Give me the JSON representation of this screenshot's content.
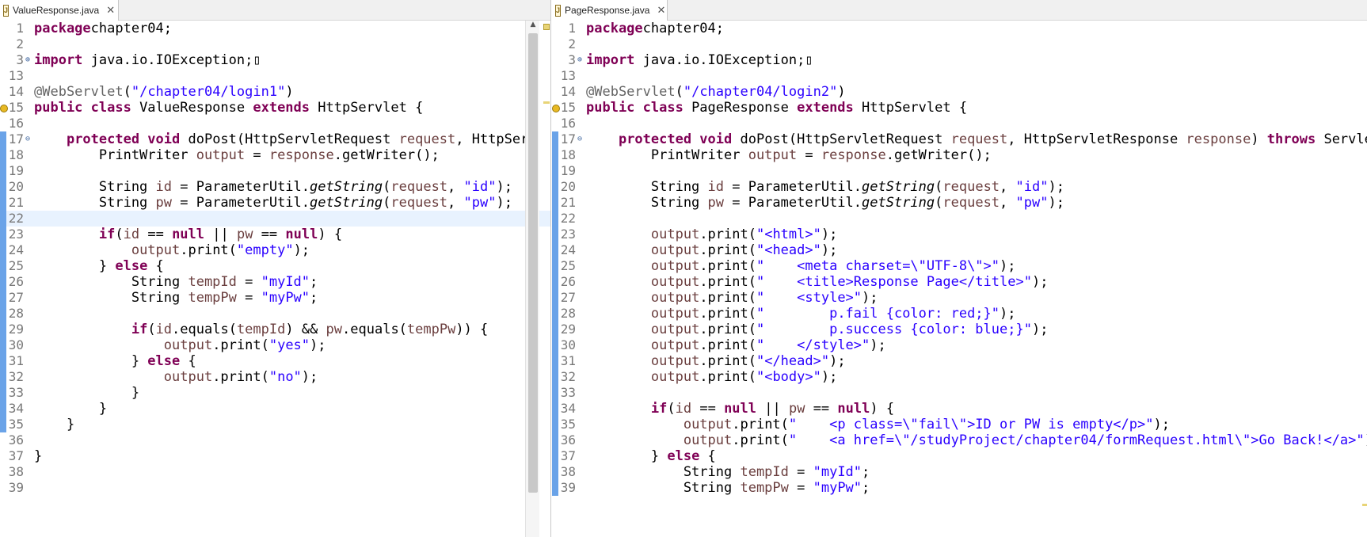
{
  "left_tab": {
    "label": "ValueResponse.java",
    "icon": "java-file-icon",
    "close": "✕"
  },
  "right_tab": {
    "label": "PageResponse.java",
    "icon": "java-file-icon",
    "close": "✕"
  },
  "left_lines": [
    {
      "n": "1",
      "marker": "",
      "warn": false,
      "hl": false,
      "t": [
        [
          "k",
          "package"
        ],
        [
          "",
          "chapter04;"
        ]
      ]
    },
    {
      "n": "2",
      "marker": "",
      "warn": false,
      "hl": false,
      "t": []
    },
    {
      "n": "3",
      "marker": "⊕",
      "warn": false,
      "hl": false,
      "t": [
        [
          "k",
          "import"
        ],
        [
          "",
          " java.io.IOException;▯"
        ]
      ]
    },
    {
      "n": "13",
      "marker": "",
      "warn": false,
      "hl": false,
      "t": []
    },
    {
      "n": "14",
      "marker": "",
      "warn": false,
      "hl": false,
      "t": [
        [
          "a",
          "@WebServlet"
        ],
        [
          "",
          "("
        ],
        [
          "s",
          "\"/chapter04/login1\""
        ],
        [
          "",
          ")"
        ]
      ]
    },
    {
      "n": "15",
      "marker": "",
      "warn": true,
      "hl": false,
      "t": [
        [
          "k",
          "public class"
        ],
        [
          "",
          " ValueResponse "
        ],
        [
          "k",
          "extends"
        ],
        [
          "",
          " HttpServlet {"
        ]
      ]
    },
    {
      "n": "16",
      "marker": "",
      "warn": false,
      "hl": false,
      "t": []
    },
    {
      "n": "17",
      "marker": "⊖",
      "warn": false,
      "hl": false,
      "t": [
        [
          "",
          "    "
        ],
        [
          "k",
          "protected void"
        ],
        [
          "",
          " doPost(HttpServletRequest "
        ],
        [
          "v",
          "request"
        ],
        [
          "",
          ", HttpServ"
        ]
      ]
    },
    {
      "n": "18",
      "marker": "",
      "warn": false,
      "hl": false,
      "t": [
        [
          "",
          "        PrintWriter "
        ],
        [
          "v",
          "output"
        ],
        [
          "",
          " = "
        ],
        [
          "v",
          "response"
        ],
        [
          "",
          ".getWriter();"
        ]
      ]
    },
    {
      "n": "19",
      "marker": "",
      "warn": false,
      "hl": false,
      "t": []
    },
    {
      "n": "20",
      "marker": "",
      "warn": false,
      "hl": false,
      "t": [
        [
          "",
          "        String "
        ],
        [
          "v",
          "id"
        ],
        [
          "",
          " = ParameterUtil."
        ],
        [
          "i",
          "getString"
        ],
        [
          "",
          "("
        ],
        [
          "v",
          "request"
        ],
        [
          "",
          ", "
        ],
        [
          "s",
          "\"id\""
        ],
        [
          "",
          ");"
        ]
      ]
    },
    {
      "n": "21",
      "marker": "",
      "warn": false,
      "hl": false,
      "t": [
        [
          "",
          "        String "
        ],
        [
          "v",
          "pw"
        ],
        [
          "",
          " = ParameterUtil."
        ],
        [
          "i",
          "getString"
        ],
        [
          "",
          "("
        ],
        [
          "v",
          "request"
        ],
        [
          "",
          ", "
        ],
        [
          "s",
          "\"pw\""
        ],
        [
          "",
          ");"
        ]
      ]
    },
    {
      "n": "22",
      "marker": "",
      "warn": false,
      "hl": true,
      "t": []
    },
    {
      "n": "23",
      "marker": "",
      "warn": false,
      "hl": false,
      "t": [
        [
          "",
          "        "
        ],
        [
          "k",
          "if"
        ],
        [
          "",
          "("
        ],
        [
          "v",
          "id"
        ],
        [
          "",
          " == "
        ],
        [
          "k",
          "null"
        ],
        [
          "",
          " || "
        ],
        [
          "v",
          "pw"
        ],
        [
          "",
          " == "
        ],
        [
          "k",
          "null"
        ],
        [
          "",
          ") {"
        ]
      ]
    },
    {
      "n": "24",
      "marker": "",
      "warn": false,
      "hl": false,
      "t": [
        [
          "",
          "            "
        ],
        [
          "v",
          "output"
        ],
        [
          "",
          ".print("
        ],
        [
          "s",
          "\"empty\""
        ],
        [
          "",
          ");"
        ]
      ]
    },
    {
      "n": "25",
      "marker": "",
      "warn": false,
      "hl": false,
      "t": [
        [
          "",
          "        } "
        ],
        [
          "k",
          "else"
        ],
        [
          "",
          " {"
        ]
      ]
    },
    {
      "n": "26",
      "marker": "",
      "warn": false,
      "hl": false,
      "t": [
        [
          "",
          "            String "
        ],
        [
          "v",
          "tempId"
        ],
        [
          "",
          " = "
        ],
        [
          "s",
          "\"myId\""
        ],
        [
          "",
          ";"
        ]
      ]
    },
    {
      "n": "27",
      "marker": "",
      "warn": false,
      "hl": false,
      "t": [
        [
          "",
          "            String "
        ],
        [
          "v",
          "tempPw"
        ],
        [
          "",
          " = "
        ],
        [
          "s",
          "\"myPw\""
        ],
        [
          "",
          ";"
        ]
      ]
    },
    {
      "n": "28",
      "marker": "",
      "warn": false,
      "hl": false,
      "t": []
    },
    {
      "n": "29",
      "marker": "",
      "warn": false,
      "hl": false,
      "t": [
        [
          "",
          "            "
        ],
        [
          "k",
          "if"
        ],
        [
          "",
          "("
        ],
        [
          "v",
          "id"
        ],
        [
          "",
          ".equals("
        ],
        [
          "v",
          "tempId"
        ],
        [
          "",
          ") && "
        ],
        [
          "v",
          "pw"
        ],
        [
          "",
          ".equals("
        ],
        [
          "v",
          "tempPw"
        ],
        [
          "",
          ")) {"
        ]
      ]
    },
    {
      "n": "30",
      "marker": "",
      "warn": false,
      "hl": false,
      "t": [
        [
          "",
          "                "
        ],
        [
          "v",
          "output"
        ],
        [
          "",
          ".print("
        ],
        [
          "s",
          "\"yes\""
        ],
        [
          "",
          ");"
        ]
      ]
    },
    {
      "n": "31",
      "marker": "",
      "warn": false,
      "hl": false,
      "t": [
        [
          "",
          "            } "
        ],
        [
          "k",
          "else"
        ],
        [
          "",
          " {"
        ]
      ]
    },
    {
      "n": "32",
      "marker": "",
      "warn": false,
      "hl": false,
      "t": [
        [
          "",
          "                "
        ],
        [
          "v",
          "output"
        ],
        [
          "",
          ".print("
        ],
        [
          "s",
          "\"no\""
        ],
        [
          "",
          ");"
        ]
      ]
    },
    {
      "n": "33",
      "marker": "",
      "warn": false,
      "hl": false,
      "t": [
        [
          "",
          "            }"
        ]
      ]
    },
    {
      "n": "34",
      "marker": "",
      "warn": false,
      "hl": false,
      "t": [
        [
          "",
          "        }"
        ]
      ]
    },
    {
      "n": "35",
      "marker": "",
      "warn": false,
      "hl": false,
      "t": [
        [
          "",
          "    }"
        ]
      ]
    },
    {
      "n": "36",
      "marker": "",
      "warn": false,
      "hl": false,
      "t": []
    },
    {
      "n": "37",
      "marker": "",
      "warn": false,
      "hl": false,
      "t": [
        [
          "",
          "}"
        ]
      ]
    },
    {
      "n": "38",
      "marker": "",
      "warn": false,
      "hl": false,
      "t": []
    },
    {
      "n": "39",
      "marker": "",
      "warn": false,
      "hl": false,
      "t": []
    }
  ],
  "right_lines": [
    {
      "n": "1",
      "marker": "",
      "warn": false,
      "hl": false,
      "t": [
        [
          "k",
          "package"
        ],
        [
          "",
          "chapter04;"
        ]
      ]
    },
    {
      "n": "2",
      "marker": "",
      "warn": false,
      "hl": false,
      "t": []
    },
    {
      "n": "3",
      "marker": "⊕",
      "warn": false,
      "hl": false,
      "t": [
        [
          "k",
          "import"
        ],
        [
          "",
          " java.io.IOException;▯"
        ]
      ]
    },
    {
      "n": "13",
      "marker": "",
      "warn": false,
      "hl": false,
      "t": []
    },
    {
      "n": "14",
      "marker": "",
      "warn": false,
      "hl": false,
      "t": [
        [
          "a",
          "@WebServlet"
        ],
        [
          "",
          "("
        ],
        [
          "s",
          "\"/chapter04/login2\""
        ],
        [
          "",
          ")"
        ]
      ]
    },
    {
      "n": "15",
      "marker": "",
      "warn": true,
      "hl": false,
      "t": [
        [
          "k",
          "public class"
        ],
        [
          "",
          " PageResponse "
        ],
        [
          "k",
          "extends"
        ],
        [
          "",
          " HttpServlet {"
        ]
      ]
    },
    {
      "n": "16",
      "marker": "",
      "warn": false,
      "hl": false,
      "t": []
    },
    {
      "n": "17",
      "marker": "⊖",
      "warn": false,
      "hl": false,
      "t": [
        [
          "",
          "    "
        ],
        [
          "k",
          "protected void"
        ],
        [
          "",
          " doPost(HttpServletRequest "
        ],
        [
          "v",
          "request"
        ],
        [
          "",
          ", HttpServletResponse "
        ],
        [
          "v",
          "response"
        ],
        [
          "",
          ") "
        ],
        [
          "k",
          "throws"
        ],
        [
          "",
          " ServletE"
        ]
      ]
    },
    {
      "n": "18",
      "marker": "",
      "warn": false,
      "hl": false,
      "t": [
        [
          "",
          "        PrintWriter "
        ],
        [
          "v",
          "output"
        ],
        [
          "",
          " = "
        ],
        [
          "v",
          "response"
        ],
        [
          "",
          ".getWriter();"
        ]
      ]
    },
    {
      "n": "19",
      "marker": "",
      "warn": false,
      "hl": false,
      "t": []
    },
    {
      "n": "20",
      "marker": "",
      "warn": false,
      "hl": false,
      "t": [
        [
          "",
          "        String "
        ],
        [
          "v",
          "id"
        ],
        [
          "",
          " = ParameterUtil."
        ],
        [
          "i",
          "getString"
        ],
        [
          "",
          "("
        ],
        [
          "v",
          "request"
        ],
        [
          "",
          ", "
        ],
        [
          "s",
          "\"id\""
        ],
        [
          "",
          ");"
        ]
      ]
    },
    {
      "n": "21",
      "marker": "",
      "warn": false,
      "hl": false,
      "t": [
        [
          "",
          "        String "
        ],
        [
          "v",
          "pw"
        ],
        [
          "",
          " = ParameterUtil."
        ],
        [
          "i",
          "getString"
        ],
        [
          "",
          "("
        ],
        [
          "v",
          "request"
        ],
        [
          "",
          ", "
        ],
        [
          "s",
          "\"pw\""
        ],
        [
          "",
          ");"
        ]
      ]
    },
    {
      "n": "22",
      "marker": "",
      "warn": false,
      "hl": false,
      "t": []
    },
    {
      "n": "23",
      "marker": "",
      "warn": false,
      "hl": false,
      "t": [
        [
          "",
          "        "
        ],
        [
          "v",
          "output"
        ],
        [
          "",
          ".print("
        ],
        [
          "s",
          "\"<html>\""
        ],
        [
          "",
          ");"
        ]
      ]
    },
    {
      "n": "24",
      "marker": "",
      "warn": false,
      "hl": false,
      "t": [
        [
          "",
          "        "
        ],
        [
          "v",
          "output"
        ],
        [
          "",
          ".print("
        ],
        [
          "s",
          "\"<head>\""
        ],
        [
          "",
          ");"
        ]
      ]
    },
    {
      "n": "25",
      "marker": "",
      "warn": false,
      "hl": false,
      "t": [
        [
          "",
          "        "
        ],
        [
          "v",
          "output"
        ],
        [
          "",
          ".print("
        ],
        [
          "s",
          "\"    <meta charset=\\\"UTF-8\\\">\""
        ],
        [
          "",
          ");"
        ]
      ]
    },
    {
      "n": "26",
      "marker": "",
      "warn": false,
      "hl": false,
      "t": [
        [
          "",
          "        "
        ],
        [
          "v",
          "output"
        ],
        [
          "",
          ".print("
        ],
        [
          "s",
          "\"    <title>Response Page</title>\""
        ],
        [
          "",
          ");"
        ]
      ]
    },
    {
      "n": "27",
      "marker": "",
      "warn": false,
      "hl": false,
      "t": [
        [
          "",
          "        "
        ],
        [
          "v",
          "output"
        ],
        [
          "",
          ".print("
        ],
        [
          "s",
          "\"    <style>\""
        ],
        [
          "",
          ");"
        ]
      ]
    },
    {
      "n": "28",
      "marker": "",
      "warn": false,
      "hl": false,
      "t": [
        [
          "",
          "        "
        ],
        [
          "v",
          "output"
        ],
        [
          "",
          ".print("
        ],
        [
          "s",
          "\"        p.fail {color: red;}\""
        ],
        [
          "",
          ");"
        ]
      ]
    },
    {
      "n": "29",
      "marker": "",
      "warn": false,
      "hl": false,
      "t": [
        [
          "",
          "        "
        ],
        [
          "v",
          "output"
        ],
        [
          "",
          ".print("
        ],
        [
          "s",
          "\"        p.success {color: blue;}\""
        ],
        [
          "",
          ");"
        ]
      ]
    },
    {
      "n": "30",
      "marker": "",
      "warn": false,
      "hl": false,
      "t": [
        [
          "",
          "        "
        ],
        [
          "v",
          "output"
        ],
        [
          "",
          ".print("
        ],
        [
          "s",
          "\"    </style>\""
        ],
        [
          "",
          ");"
        ]
      ]
    },
    {
      "n": "31",
      "marker": "",
      "warn": false,
      "hl": false,
      "t": [
        [
          "",
          "        "
        ],
        [
          "v",
          "output"
        ],
        [
          "",
          ".print("
        ],
        [
          "s",
          "\"</head>\""
        ],
        [
          "",
          ");"
        ]
      ]
    },
    {
      "n": "32",
      "marker": "",
      "warn": false,
      "hl": false,
      "t": [
        [
          "",
          "        "
        ],
        [
          "v",
          "output"
        ],
        [
          "",
          ".print("
        ],
        [
          "s",
          "\"<body>\""
        ],
        [
          "",
          ");"
        ]
      ]
    },
    {
      "n": "33",
      "marker": "",
      "warn": false,
      "hl": false,
      "t": []
    },
    {
      "n": "34",
      "marker": "",
      "warn": false,
      "hl": false,
      "t": [
        [
          "",
          "        "
        ],
        [
          "k",
          "if"
        ],
        [
          "",
          "("
        ],
        [
          "v",
          "id"
        ],
        [
          "",
          " == "
        ],
        [
          "k",
          "null"
        ],
        [
          "",
          " || "
        ],
        [
          "v",
          "pw"
        ],
        [
          "",
          " == "
        ],
        [
          "k",
          "null"
        ],
        [
          "",
          ") {"
        ]
      ]
    },
    {
      "n": "35",
      "marker": "",
      "warn": false,
      "hl": false,
      "t": [
        [
          "",
          "            "
        ],
        [
          "v",
          "output"
        ],
        [
          "",
          ".print("
        ],
        [
          "s",
          "\"    <p class=\\\"fail\\\">ID or PW is empty</p>\""
        ],
        [
          "",
          ");"
        ]
      ]
    },
    {
      "n": "36",
      "marker": "",
      "warn": false,
      "hl": false,
      "t": [
        [
          "",
          "            "
        ],
        [
          "v",
          "output"
        ],
        [
          "",
          ".print("
        ],
        [
          "s",
          "\"    <a href=\\\"/studyProject/chapter04/formRequest.html\\\">Go Back!</a>\""
        ],
        [
          "",
          ");"
        ]
      ]
    },
    {
      "n": "37",
      "marker": "",
      "warn": false,
      "hl": false,
      "t": [
        [
          "",
          "        } "
        ],
        [
          "k",
          "else"
        ],
        [
          "",
          " {"
        ]
      ]
    },
    {
      "n": "38",
      "marker": "",
      "warn": false,
      "hl": false,
      "t": [
        [
          "",
          "            String "
        ],
        [
          "v",
          "tempId"
        ],
        [
          "",
          " = "
        ],
        [
          "s",
          "\"myId\""
        ],
        [
          "",
          ";"
        ]
      ]
    },
    {
      "n": "39",
      "marker": "",
      "warn": false,
      "hl": false,
      "t": [
        [
          "",
          "            String "
        ],
        [
          "v",
          "tempPw"
        ],
        [
          "",
          " = "
        ],
        [
          "s",
          "\"myPw\""
        ],
        [
          "",
          ";"
        ]
      ]
    }
  ],
  "colors": {
    "keyword": "#7f0055",
    "string": "#2a00ff",
    "variable": "#6a3e3e",
    "annotation": "#646464",
    "line_highlight": "#e8f2fe",
    "change_bar": "#6aa3e8"
  }
}
